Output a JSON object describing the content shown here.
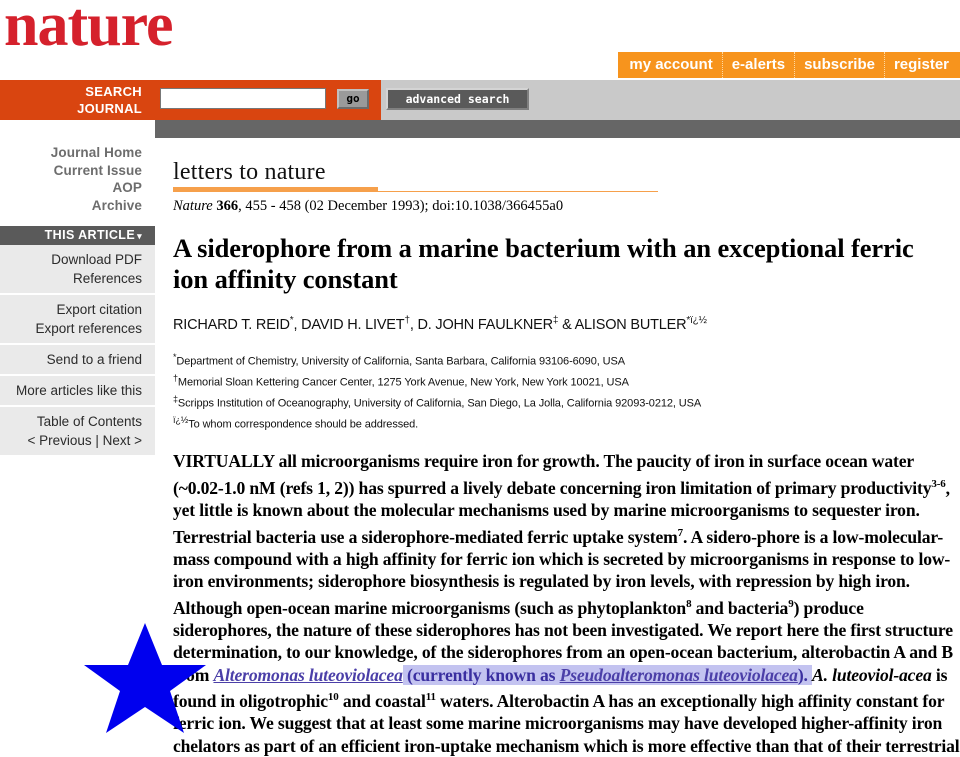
{
  "brand": {
    "logo_text": "nature",
    "logo_color": "#d5212c"
  },
  "top_nav": {
    "items": [
      {
        "label": "my account"
      },
      {
        "label": "e-alerts"
      },
      {
        "label": "subscribe"
      },
      {
        "label": "register"
      }
    ],
    "background": "#f7941d"
  },
  "search": {
    "label_line1": "SEARCH",
    "label_line2": "JOURNAL",
    "value": "",
    "placeholder": "",
    "go_label": "go",
    "advanced_label": "advanced search",
    "band_color": "#d94510"
  },
  "sidebar": {
    "journal_nav": [
      {
        "label": "Journal Home"
      },
      {
        "label": "Current Issue"
      },
      {
        "label": "AOP"
      },
      {
        "label": "Archive"
      }
    ],
    "this_article_label": "THIS ARTICLE",
    "this_article_caret": "▾",
    "groups": [
      {
        "items": [
          {
            "label": "Download PDF"
          },
          {
            "label": "References"
          }
        ]
      },
      {
        "items": [
          {
            "label": "Export citation"
          },
          {
            "label": "Export references"
          }
        ]
      },
      {
        "items": [
          {
            "label": "Send to a friend"
          }
        ]
      },
      {
        "items": [
          {
            "label": "More articles like this"
          }
        ]
      },
      {
        "items": [
          {
            "label": "Table of Contents"
          },
          {
            "label": "< Previous | Next >"
          }
        ]
      }
    ]
  },
  "article": {
    "section_heading": "letters to nature",
    "citation": {
      "journal": "Nature",
      "volume": "366",
      "pages": ", 455 - 458 (02 December 1993); doi:10.1038/366455a0"
    },
    "title": "A siderophore from a marine bacterium with an exceptional ferric ion affinity constant",
    "authors_prefix": "RICHARD T. REID",
    "authors_full": "RICHARD T. REID*, DAVID H. LIVET†, D. JOHN FAULKNER‡ & ALISON BUTLER*ï¿½",
    "affiliations": [
      {
        "marker": "*",
        "text": "Department of Chemistry, University of California, Santa Barbara, California 93106-6090, USA"
      },
      {
        "marker": "†",
        "text": "Memorial Sloan Kettering Cancer Center, 1275 York Avenue, New York, New York 10021, USA"
      },
      {
        "marker": "‡",
        "text": "Scripps Institution of Oceanography, University of California, San Diego, La Jolla, California 92093-0212, USA"
      },
      {
        "marker": "ï¿½",
        "text": "To whom correspondence should be addressed."
      }
    ],
    "abstract_parts": {
      "p1": "VIRTUALLY all microorganisms require iron for growth. The paucity of iron in surface ocean water (~0.02-1.0 nM (refs 1, 2)) has spurred a lively debate concerning iron limitation of primary productivity",
      "sup1": "3-6",
      "p2": ", yet little is known about the molecular mechanisms used by marine microorganisms to sequester iron. Terrestrial bacteria use a siderophore-mediated ferric uptake system",
      "sup2": "7",
      "p3": ". A sidero-phore is a low-molecular-mass compound with a high affinity for ferric ion which is secreted by microorganisms in response to low-iron environments; siderophore biosynthesis is regulated by iron levels, with repression by high iron. Although open-ocean marine microorganisms (such as phytoplankton",
      "sup3": "8",
      "p4": " and bacteria",
      "sup4": "9",
      "p5": ") produce siderophores, the nature of these siderophores has not been investigated. We report here the first structure determination, to our knowledge, of the siderophores from an open-ocean bacterium, alterobactin A and B from ",
      "link1": "Alteromonas luteoviolacea",
      "hl_open": " (currently known as ",
      "link2": "Pseudoalteromonas luteoviolacea",
      "hl_close": "). ",
      "p6_ital_a": "A. luteoviol-acea",
      "p6": " is found in oligotrophic",
      "sup5": "10",
      "p7": " and coastal",
      "sup6": "11",
      "p8": " waters. Alterobactin A has an exceptionally high affinity constant for ferric ion. We suggest that at least some marine microorganisms may have developed higher-affinity iron chelators as part of an efficient iron-uptake mechanism which is more effective than that of their terrestrial"
    },
    "highlight_color": "#c3c3f0",
    "link_color": "#4b3fa8"
  },
  "annotation": {
    "star_color": "#0000ee",
    "star_points": 5
  }
}
